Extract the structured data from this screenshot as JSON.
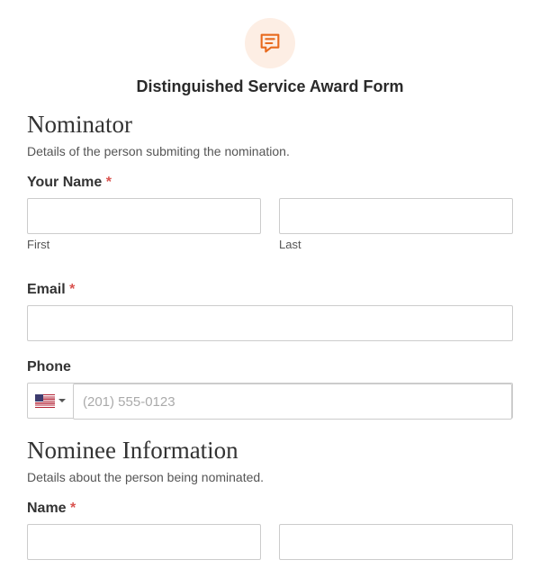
{
  "header": {
    "title": "Distinguished Service Award Form"
  },
  "sections": {
    "nominator": {
      "heading": "Nominator",
      "description": "Details of the person submiting the nomination.",
      "name": {
        "label": "Your Name",
        "required_marker": "*",
        "first_sub": "First",
        "last_sub": "Last"
      },
      "email": {
        "label": "Email",
        "required_marker": "*"
      },
      "phone": {
        "label": "Phone",
        "placeholder": "(201) 555-0123"
      }
    },
    "nominee": {
      "heading": "Nominee Information",
      "description": "Details about the person being nominated.",
      "name": {
        "label": "Name",
        "required_marker": "*"
      }
    }
  }
}
